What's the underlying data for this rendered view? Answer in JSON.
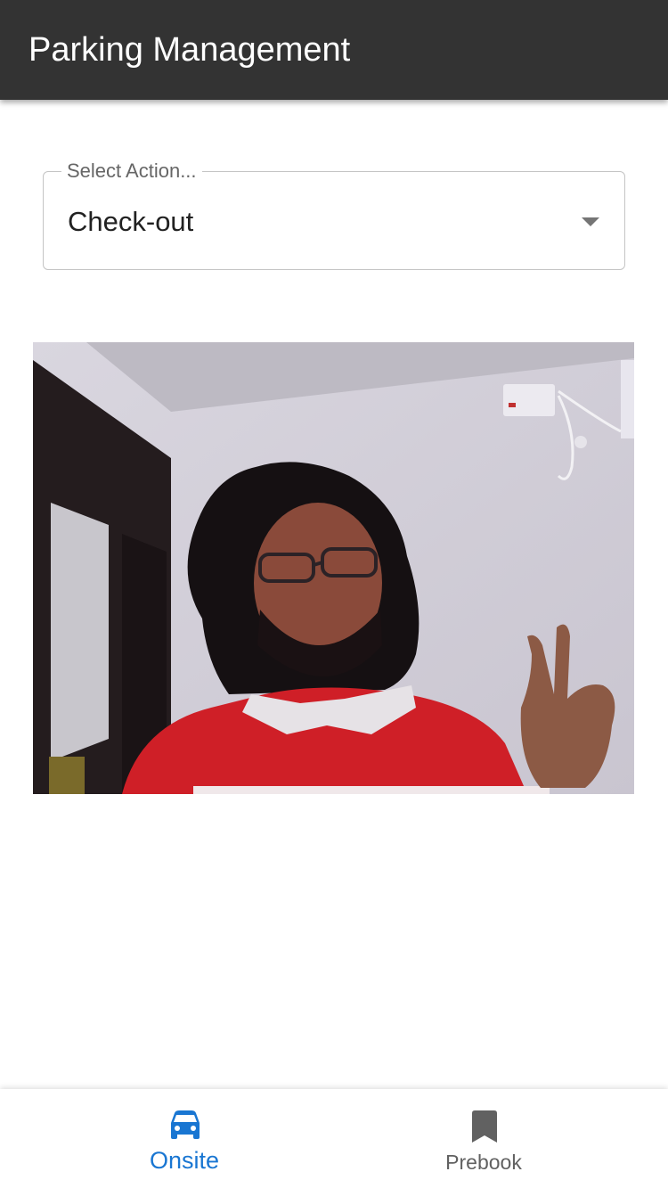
{
  "app_bar": {
    "title": "Parking Management"
  },
  "action_select": {
    "label": "Select Action...",
    "value": "Check-out"
  },
  "camera_preview": {
    "content": "live webcam feed"
  },
  "bottom_nav": {
    "items": [
      {
        "label": "Onsite",
        "icon": "car-icon",
        "active": true
      },
      {
        "label": "Prebook",
        "icon": "bookmark-icon",
        "active": false
      }
    ]
  },
  "colors": {
    "app_bar": "#333333",
    "accent": "#1976d2",
    "inactive": "#616161",
    "border": "#c4c4c4"
  }
}
